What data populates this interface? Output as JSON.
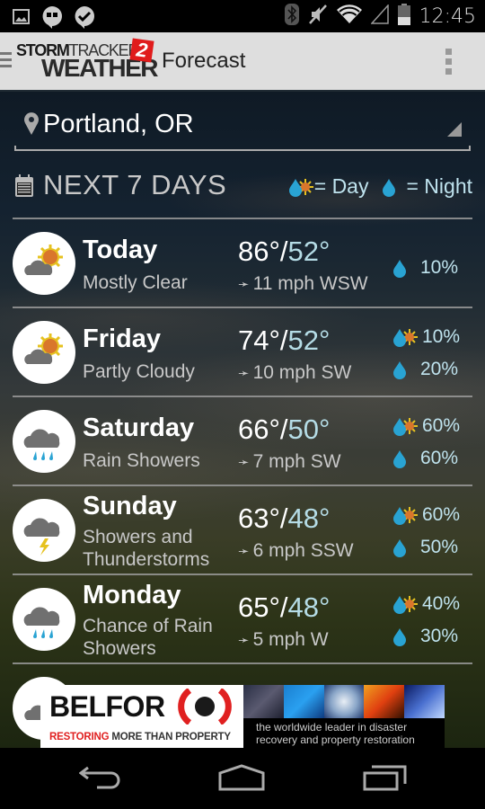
{
  "status_bar": {
    "time": "12:45",
    "left_icons": [
      "gallery-icon",
      "hangouts-icon",
      "check-message-icon"
    ],
    "right_icons": [
      "bluetooth-icon",
      "muted-icon",
      "wifi-icon",
      "cell-signal-icon",
      "battery-icon"
    ]
  },
  "action_bar": {
    "logo_line1_bold": "STORM",
    "logo_line1_thin": "TRACKER",
    "logo_line2": "WEATHER",
    "logo_badge": "2",
    "title": "Forecast"
  },
  "location": {
    "value": "Portland, OR"
  },
  "section": {
    "title": "NEXT 7 DAYS",
    "legend_day": "= Day",
    "legend_night": "= Night"
  },
  "forecast": [
    {
      "day": "Today",
      "condition": "Mostly Clear",
      "high": "86°",
      "low": "52°",
      "wind": "11 mph WSW",
      "icon": "partly-sunny",
      "day_precip": null,
      "night_precip": "10%"
    },
    {
      "day": "Friday",
      "condition": "Partly Cloudy",
      "high": "74°",
      "low": "52°",
      "wind": "10 mph SW",
      "icon": "partly-sunny",
      "day_precip": "10%",
      "night_precip": "20%"
    },
    {
      "day": "Saturday",
      "condition": "Rain Showers",
      "high": "66°",
      "low": "50°",
      "wind": "7 mph SW",
      "icon": "rain",
      "day_precip": "60%",
      "night_precip": "60%"
    },
    {
      "day": "Sunday",
      "condition": "Showers and Thunderstorms",
      "high": "63°",
      "low": "48°",
      "wind": "6 mph SSW",
      "icon": "thunderstorm",
      "day_precip": "60%",
      "night_precip": "50%"
    },
    {
      "day": "Monday",
      "condition": "Chance of Rain Showers",
      "high": "65°",
      "low": "48°",
      "wind": "5 mph W",
      "icon": "rain",
      "day_precip": "40%",
      "night_precip": "30%"
    }
  ],
  "ad": {
    "brand": "BELFOR",
    "tagline_red": "RESTORING",
    "tagline_rest": " MORE THAN PROPERTY",
    "caption_line1": "the worldwide leader in disaster",
    "caption_line2": "recovery and property restoration"
  },
  "colors": {
    "accent_blue": "#29a3d3",
    "sun_orange": "#d9762c",
    "sun_yellow": "#e6c21f",
    "brand_red": "#e01b1b"
  }
}
